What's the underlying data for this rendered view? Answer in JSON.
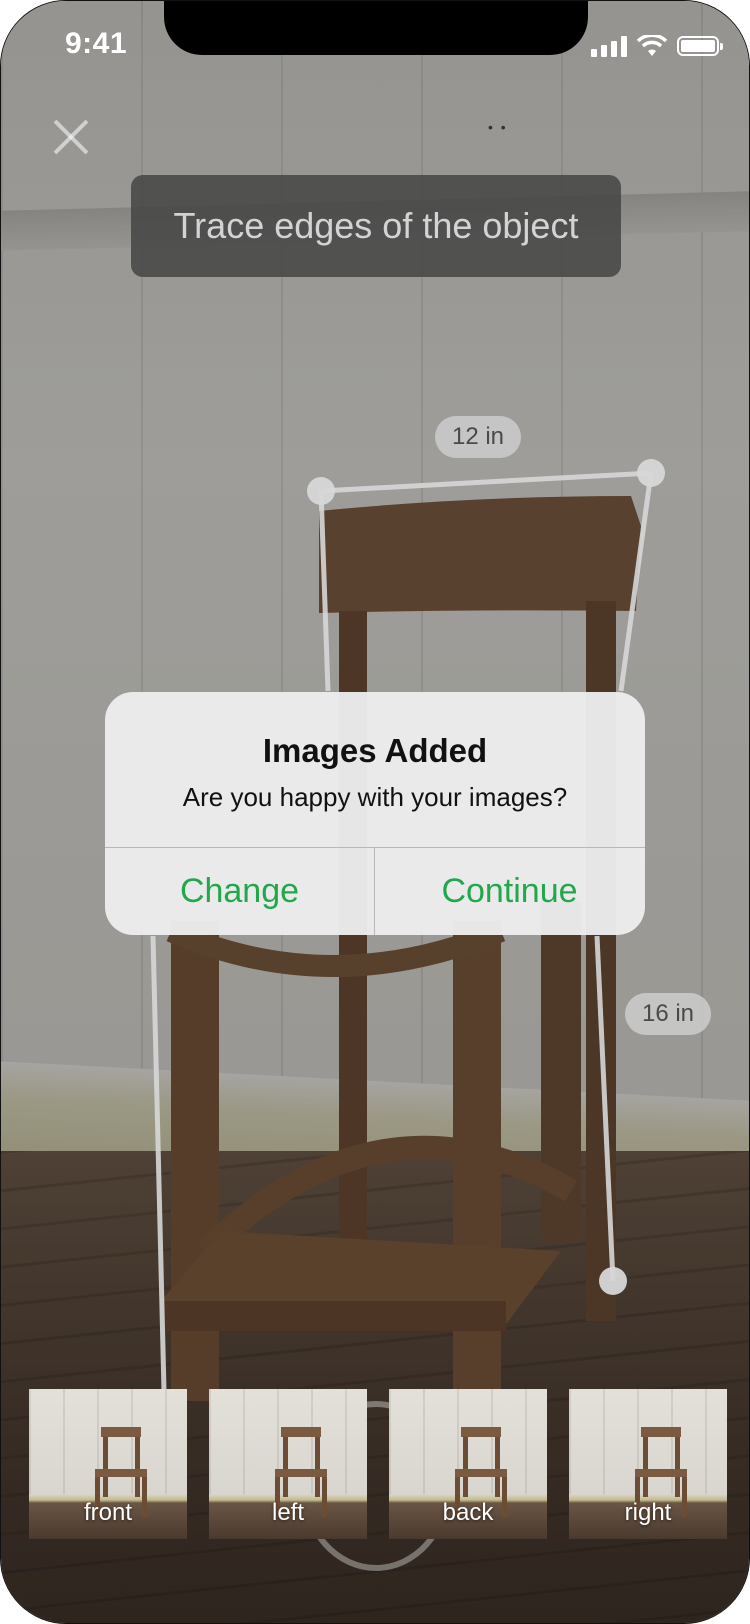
{
  "status": {
    "time": "9:41"
  },
  "instruction": "Trace edges of the object",
  "measurements": {
    "top": "12 in",
    "side": "16 in"
  },
  "alert": {
    "title": "Images Added",
    "message": "Are you happy with your images?",
    "buttons": {
      "left": "Change",
      "right": "Continue"
    },
    "button_color": "#22a84b"
  },
  "thumbnails": [
    {
      "label": "front"
    },
    {
      "label": "left"
    },
    {
      "label": "back"
    },
    {
      "label": "right"
    }
  ],
  "icons": {
    "close": "close-icon",
    "signal": "signal-icon",
    "wifi": "wifi-icon",
    "battery": "battery-icon"
  }
}
